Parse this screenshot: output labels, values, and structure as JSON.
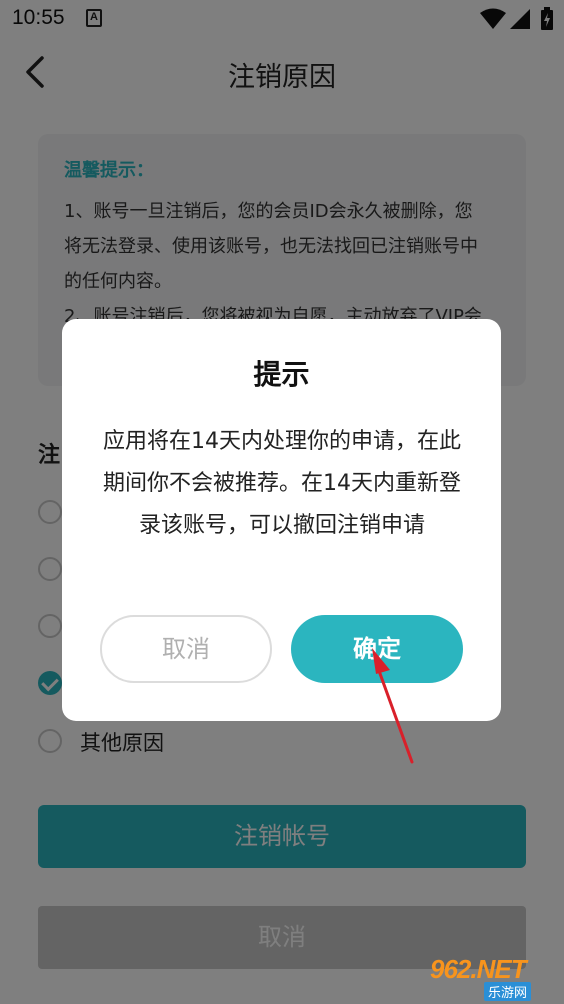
{
  "status_bar": {
    "time": "10:55",
    "notification_letter": "A"
  },
  "header": {
    "title": "注销原因"
  },
  "notice": {
    "title": "温馨提示：",
    "lines": [
      "1、账号一旦注销后，您的会员ID会永久被删除，您",
      "将无法登录、使用该账号，也无法找回已注销账号中",
      "的任何内容。",
      "2、账号注销后，您将被视为自愿，主动放弃了VIP会"
    ]
  },
  "reasons": {
    "heading": "注",
    "items": [
      {
        "label": "",
        "checked": false
      },
      {
        "label": "",
        "checked": false
      },
      {
        "label": "",
        "checked": false
      },
      {
        "label": "",
        "checked": true
      },
      {
        "label": "其他原因",
        "checked": false
      }
    ]
  },
  "buttons": {
    "delete_account": "注销帐号",
    "cancel": "取消"
  },
  "dialog": {
    "title": "提示",
    "message": "应用将在14天内处理你的申请，在此期间你不会被推荐。在14天内重新登录该账号，可以撤回注销申请",
    "cancel_label": "取消",
    "confirm_label": "确定"
  },
  "watermark": {
    "brand": "962.NET",
    "sub": "乐游网"
  },
  "colors": {
    "accent": "#2bb5bf",
    "notice_title": "#2bb5bf",
    "annotation_arrow": "#d9202a",
    "overlay": "rgba(0,0,0,0.5)"
  }
}
